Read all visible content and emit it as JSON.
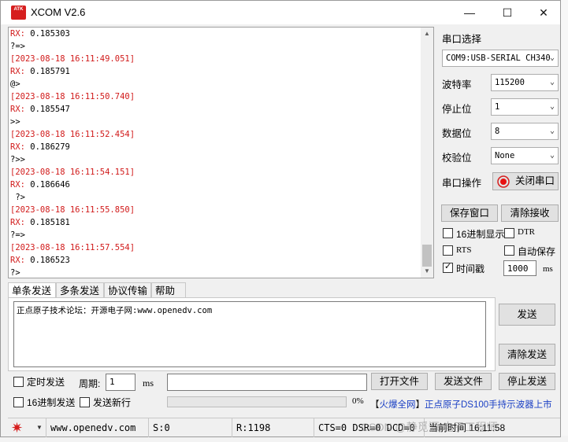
{
  "window": {
    "logo_text": "ATK",
    "title": "XCOM V2.6",
    "minimize": "—",
    "maximize": "☐",
    "close": "✕"
  },
  "rx": {
    "lines": [
      {
        "kind": "rx",
        "label": "RX:",
        "text": " 0.185303"
      },
      {
        "kind": "plain",
        "text": "?=>"
      },
      {
        "kind": "ts",
        "text": "[2023-08-18 16:11:49.051]"
      },
      {
        "kind": "rx",
        "label": "RX:",
        "text": " 0.185791"
      },
      {
        "kind": "plain",
        "text": "@>"
      },
      {
        "kind": "ts",
        "text": "[2023-08-18 16:11:50.740]"
      },
      {
        "kind": "rx",
        "label": "RX:",
        "text": " 0.185547"
      },
      {
        "kind": "plain",
        "text": ">>"
      },
      {
        "kind": "ts",
        "text": "[2023-08-18 16:11:52.454]"
      },
      {
        "kind": "rx",
        "label": "RX:",
        "text": " 0.186279"
      },
      {
        "kind": "plain",
        "text": "?>>"
      },
      {
        "kind": "ts",
        "text": "[2023-08-18 16:11:54.151]"
      },
      {
        "kind": "rx",
        "label": "RX:",
        "text": " 0.186646"
      },
      {
        "kind": "plain",
        "text": " ?>"
      },
      {
        "kind": "ts",
        "text": "[2023-08-18 16:11:55.850]"
      },
      {
        "kind": "rx",
        "label": "RX:",
        "text": " 0.185181"
      },
      {
        "kind": "plain",
        "text": "?=>"
      },
      {
        "kind": "ts",
        "text": "[2023-08-18 16:11:57.554]"
      },
      {
        "kind": "rx",
        "label": "RX:",
        "text": " 0.186523"
      },
      {
        "kind": "plain",
        "text": "?>"
      }
    ],
    "scroll_position": 0.9
  },
  "settings": {
    "port_select_label": "串口选择",
    "port_value": "COM9:USB-SERIAL CH340",
    "baud_label": "波特率",
    "baud_value": "115200",
    "stopbit_label": "停止位",
    "stopbit_value": "1",
    "databit_label": "数据位",
    "databit_value": "8",
    "parity_label": "校验位",
    "parity_value": "None",
    "port_op_label": "串口操作",
    "close_port_button": "关闭串口",
    "save_window_button": "保存窗口",
    "clear_rx_button": "清除接收",
    "hex_display_label": "16进制显示",
    "dtr_label": "DTR",
    "rts_label": "RTS",
    "auto_save_label": "自动保存",
    "timestamp_label": "时间戳",
    "timestamp_value": "1000",
    "timestamp_unit": "ms"
  },
  "tabs": [
    {
      "label": "单条发送",
      "active": true
    },
    {
      "label": "多条发送",
      "active": false
    },
    {
      "label": "协议传输",
      "active": false
    },
    {
      "label": "帮助",
      "active": false
    }
  ],
  "tx": {
    "text": "正点原子技术论坛：开源电子网:www.openedv.com",
    "send_button": "发送",
    "clear_send_button": "清除发送"
  },
  "bottom": {
    "timed_send_label": "定时发送",
    "period_label": "周期:",
    "period_value": "1",
    "period_unit": "ms",
    "open_file_button": "打开文件",
    "send_file_button": "发送文件",
    "stop_send_button": "停止发送",
    "hex_send_label": "16进制发送",
    "send_newline_label": "发送新行",
    "progress_percent": "0%",
    "progress_value": 0,
    "ad_bracket_open": "【",
    "ad_highlight": "火爆全网",
    "ad_bracket_close": "】",
    "ad_rest": "正点原子DS100手持示波器上市"
  },
  "status": {
    "url": "www.openedv.com",
    "sent": "S:0",
    "received": "R:1198",
    "lines": "CTS=0 DSR=0 DCD=0",
    "time": "当前时间 16:11:58"
  },
  "watermark": "CSDN @静觅源 电子工程师",
  "colors": {
    "timestamp": "#d11a1a",
    "accent_red": "#d61f1f",
    "ad_blue": "#1a3fc4"
  }
}
